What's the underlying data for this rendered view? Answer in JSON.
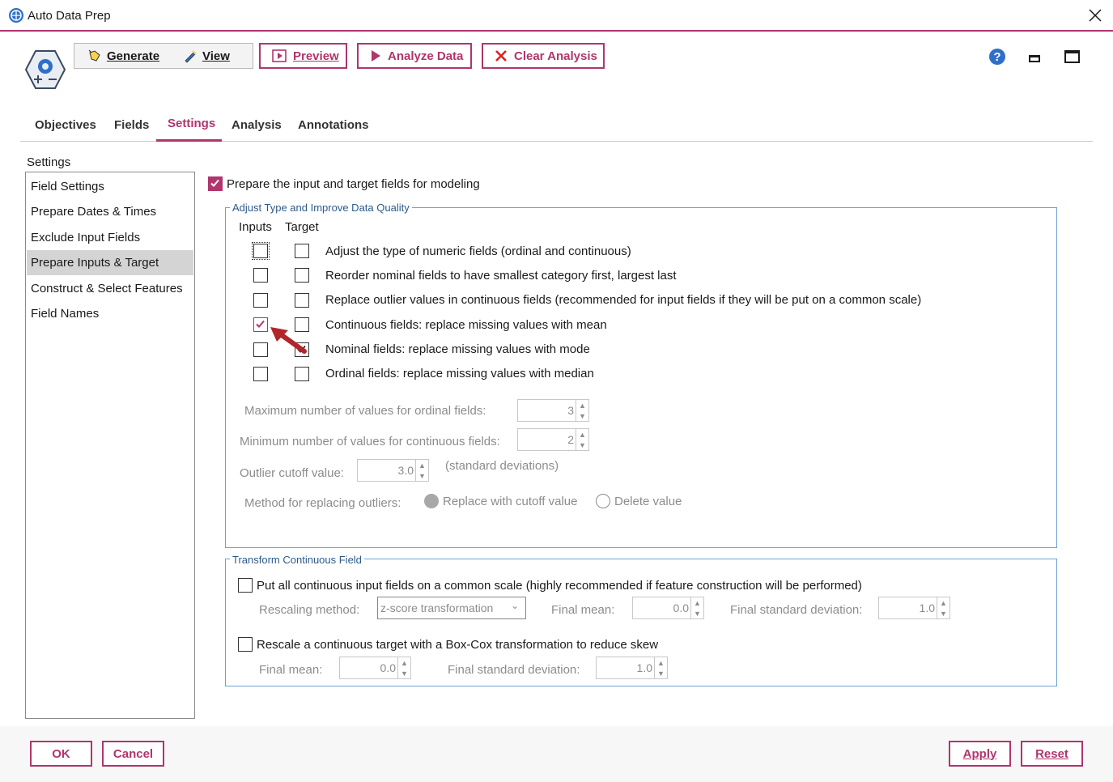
{
  "window": {
    "title": "Auto Data Prep"
  },
  "toolbar": {
    "generate_label": "Generate",
    "view_label": "View",
    "preview_label": "Preview",
    "analyze_label": "Analyze Data",
    "clear_label": "Clear Analysis"
  },
  "tabs": [
    {
      "label": "Objectives"
    },
    {
      "label": "Fields"
    },
    {
      "label": "Settings",
      "active": true
    },
    {
      "label": "Analysis"
    },
    {
      "label": "Annotations"
    }
  ],
  "sidebar": {
    "heading": "Settings",
    "items": [
      {
        "label": "Field Settings"
      },
      {
        "label": "Prepare Dates & Times"
      },
      {
        "label": "Exclude Input Fields"
      },
      {
        "label": "Prepare Inputs & Target",
        "selected": true
      },
      {
        "label": "Construct & Select Features"
      },
      {
        "label": "Field Names"
      }
    ]
  },
  "main": {
    "prepare_label": "Prepare the input and target fields for modeling",
    "prepare_checked": true,
    "adjust_group": {
      "title": "Adjust Type and Improve Data Quality",
      "inputs_header": "Inputs",
      "target_header": "Target",
      "rows": [
        {
          "label": "Adjust the type of numeric fields (ordinal and continuous)",
          "inputs": false,
          "target": false
        },
        {
          "label": "Reorder nominal fields to have smallest category first, largest last",
          "inputs": false,
          "target": false
        },
        {
          "label": "Replace outlier values in continuous fields (recommended for input fields if they will be put on a common scale)",
          "inputs": false,
          "target": false
        },
        {
          "label": "Continuous fields: replace missing values with mean",
          "inputs": true,
          "target": false
        },
        {
          "label": "Nominal fields: replace missing values with mode",
          "inputs": false,
          "target": true
        },
        {
          "label": "Ordinal fields: replace missing values with median",
          "inputs": false,
          "target": false
        }
      ],
      "max_ordinal_label": "Maximum number of values for ordinal fields:",
      "max_ordinal_value": "3",
      "min_continuous_label": "Minimum number of values for continuous fields:",
      "min_continuous_value": "2",
      "outlier_cutoff_label": "Outlier cutoff value:",
      "outlier_cutoff_value": "3.0",
      "outlier_cutoff_unit": "(standard deviations)",
      "method_label": "Method for replacing outliers:",
      "method_option_replace": "Replace with cutoff value",
      "method_option_delete": "Delete value"
    },
    "transform_group": {
      "title": "Transform Continuous Field",
      "common_scale_label": "Put all continuous input fields on a common scale (highly recommended if feature construction will be performed)",
      "rescaling_method_label": "Rescaling method:",
      "rescaling_method_value": "z-score transformation",
      "final_mean_label": "Final mean:",
      "final_mean_value": "0.0",
      "final_sd_label": "Final standard deviation:",
      "final_sd_value": "1.0",
      "boxcox_label": "Rescale a continuous target with a Box-Cox transformation to reduce skew",
      "boxcox_mean_label": "Final mean:",
      "boxcox_mean_value": "0.0",
      "boxcox_sd_label": "Final standard deviation:",
      "boxcox_sd_value": "1.0"
    }
  },
  "footer": {
    "ok_label": "OK",
    "cancel_label": "Cancel",
    "apply_label": "Apply",
    "reset_label": "Reset"
  },
  "colors": {
    "accent": "#b0356d",
    "group_border": "#6aa3d6",
    "help": "#2f6fc9"
  }
}
